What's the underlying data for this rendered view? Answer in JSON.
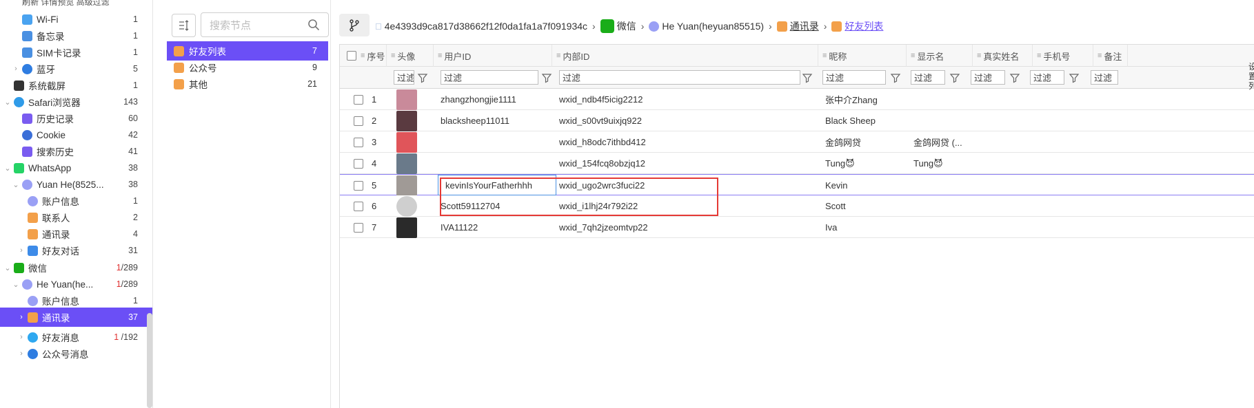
{
  "topbar": {
    "text": "刷新   详情预览 高级过滤"
  },
  "tree": {
    "items": [
      {
        "label": "Wi-Fi",
        "count": "1",
        "icon": "wifi-icon",
        "color": "#4aa3f0"
      },
      {
        "label": "备忘录",
        "count": "1",
        "icon": "notes-icon",
        "color": "#4a90e2"
      },
      {
        "label": "SIM卡记录",
        "count": "1",
        "icon": "sim-card-icon",
        "color": "#4a90e2"
      },
      {
        "label": "蓝牙",
        "count": "5",
        "icon": "bluetooth-icon",
        "color": "#2f7de1"
      },
      {
        "label": "系统截屏",
        "count": "1",
        "icon": "screenshot-icon",
        "color": "#333333"
      },
      {
        "label": "Safari浏览器",
        "count": "143",
        "icon": "safari-icon",
        "color": "#2f9be8"
      },
      {
        "label": "历史记录",
        "count": "60",
        "icon": "history-icon",
        "color": "#7a5cf0"
      },
      {
        "label": "Cookie",
        "count": "42",
        "icon": "cookie-icon",
        "color": "#3b6fd8"
      },
      {
        "label": "搜索历史",
        "count": "41",
        "icon": "search-history-icon",
        "color": "#7a5cf0"
      },
      {
        "label": "WhatsApp",
        "count": "38",
        "icon": "whatsapp-icon",
        "color": "#25d366"
      },
      {
        "label": "Yuan He(8525...",
        "count": "38",
        "icon": "user-icon",
        "color": "#9aa0f5"
      },
      {
        "label": "账户信息",
        "count": "1",
        "icon": "user-icon",
        "color": "#9aa0f5"
      },
      {
        "label": "联系人",
        "count": "2",
        "icon": "contacts-icon",
        "color": "#f3a04a"
      },
      {
        "label": "通讯录",
        "count": "4",
        "icon": "contacts-icon",
        "color": "#f3a04a"
      },
      {
        "label": "好友对话",
        "count": "31",
        "icon": "chat-icon",
        "color": "#3d8be8"
      },
      {
        "label": "微信",
        "count_red": "1",
        "count": "/289",
        "icon": "wechat-icon",
        "color": "#1aad19"
      },
      {
        "label": "He Yuan(he...",
        "count_red": "1",
        "count": "/289",
        "icon": "user-icon",
        "color": "#9aa0f5"
      },
      {
        "label": "账户信息",
        "count": "1",
        "icon": "user-icon",
        "color": "#9aa0f5"
      },
      {
        "label": "通讯录",
        "count": "37",
        "icon": "contacts-icon",
        "color": "#f3a04a"
      },
      {
        "label": "好友消息",
        "count_red": "1",
        "count": " /192",
        "icon": "message-icon",
        "color": "#2fa8f0"
      },
      {
        "label": "公众号消息",
        "count": "",
        "icon": "message-icon",
        "color": "#2f7de1"
      }
    ]
  },
  "mid": {
    "search_placeholder": "搜索节点",
    "items": [
      {
        "label": "好友列表",
        "count": "7"
      },
      {
        "label": "公众号",
        "count": "9"
      },
      {
        "label": "其他",
        "count": "21"
      }
    ]
  },
  "breadcrumb": {
    "device": "4e4393d9ca817d38662f12f0da1fa1a7f091934c",
    "app": "微信",
    "account": "He Yuan(heyuan85515)",
    "section": "通讯录",
    "current": "好友列表"
  },
  "table": {
    "columns": [
      "序号",
      "头像",
      "用户ID",
      "内部ID",
      "昵称",
      "显示名",
      "真实姓名",
      "手机号",
      "备注"
    ],
    "filter_placeholder": "过滤",
    "rows": [
      {
        "idx": "1",
        "user_id": "zhangzhongjie1111",
        "internal_id": "wxid_ndb4f5icig2212",
        "nickname": "张中介Zhang",
        "display": "",
        "avatar": "#c98a9a"
      },
      {
        "idx": "2",
        "user_id": "blacksheep11011",
        "internal_id": "wxid_s00vt9uixjq922",
        "nickname": "Black Sheep",
        "display": "",
        "avatar": "#5a3a40"
      },
      {
        "idx": "3",
        "user_id": "",
        "internal_id": "wxid_h8odc7ithbd412",
        "nickname": "金鸽网贷",
        "display": "金鸽网贷 (...",
        "avatar": "#e0555a"
      },
      {
        "idx": "4",
        "user_id": "",
        "internal_id": "wxid_154fcq8obzjq12",
        "nickname": "Tung😈",
        "display": "Tung😈",
        "avatar": "#6a7a8a"
      },
      {
        "idx": "5",
        "user_id": "kevinIsYourFatherhhh",
        "internal_id": "wxid_ugo2wrc3fuci22",
        "nickname": "Kevin",
        "display": "",
        "avatar": "#a09a96"
      },
      {
        "idx": "6",
        "user_id": "Scott59112704",
        "internal_id": "wxid_i1lhj24r792i22",
        "nickname": "Scott",
        "display": "",
        "avatar": "#cfcfcf"
      },
      {
        "idx": "7",
        "user_id": "IVA11122",
        "internal_id": "wxid_7qh2jzeomtvp22",
        "nickname": "Iva",
        "display": "",
        "avatar": "#2a2a2a"
      }
    ]
  },
  "right_edge_text": "设\n置\n列",
  "colors": {
    "accent": "#6b4ff6",
    "highlight_box": "#e53935"
  }
}
